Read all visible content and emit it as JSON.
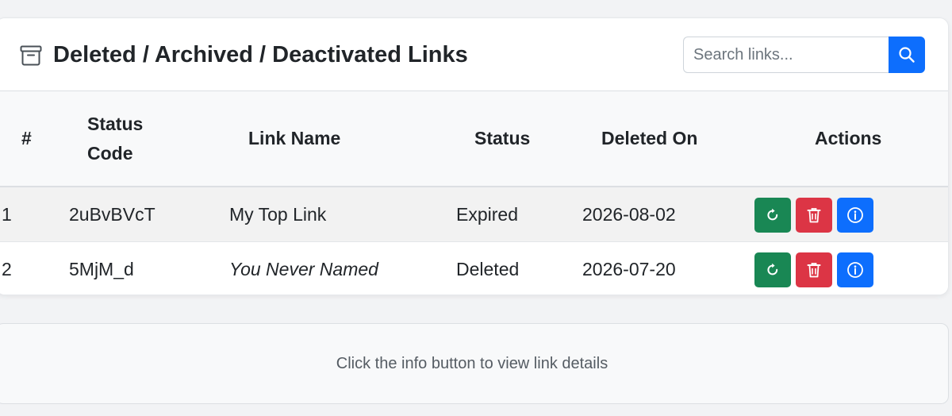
{
  "header": {
    "title": "Deleted / Archived / Deactivated Links",
    "title_icon": "archive-icon"
  },
  "search": {
    "placeholder": "Search links...",
    "value": "",
    "button_icon": "search-icon"
  },
  "table": {
    "columns": {
      "index": "#",
      "status_code_line1": "Status",
      "status_code_line2": "Code",
      "link_name": "Link Name",
      "status": "Status",
      "deleted_on": "Deleted On",
      "actions": "Actions"
    },
    "rows": [
      {
        "index": "1",
        "status_code": "2uBvBVcT",
        "link_name": "My Top Link",
        "link_name_italic": false,
        "status": "Expired",
        "deleted_on": "2026-08-02"
      },
      {
        "index": "2",
        "status_code": "5MjM_d",
        "link_name": "You Never Named",
        "link_name_italic": true,
        "status": "Deleted",
        "deleted_on": "2026-07-20"
      }
    ],
    "action_icons": [
      "restore-icon",
      "trash-icon",
      "info-icon"
    ]
  },
  "details_panel": {
    "text": "Click the info button to view link details"
  },
  "colors": {
    "primary": "#0d6efd",
    "success": "#198754",
    "danger": "#dc3545"
  }
}
